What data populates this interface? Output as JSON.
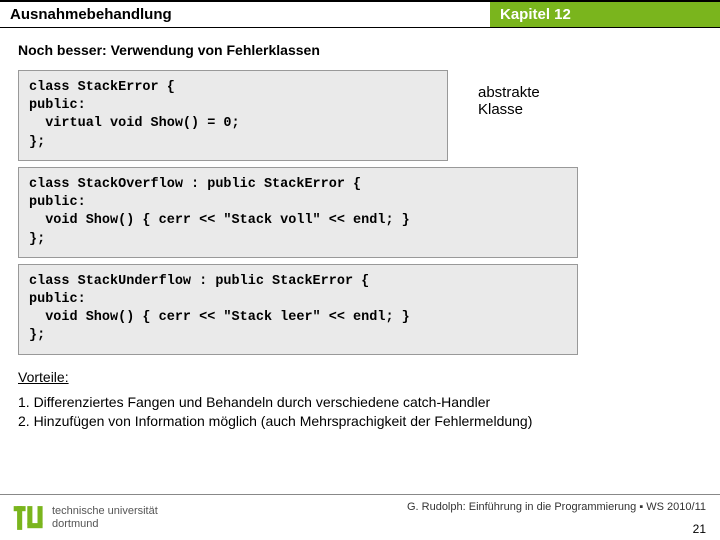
{
  "header": {
    "title": "Ausnahmebehandlung",
    "chapter": "Kapitel 12"
  },
  "subtitle": "Noch besser: Verwendung von Fehlerklassen",
  "code1": "class StackError {\npublic:\n  virtual void Show() = 0;\n};",
  "annot1": "abstrakte\nKlasse",
  "code2": "class StackOverflow : public StackError {\npublic:\n  void Show() { cerr << \"Stack voll\" << endl; }\n};",
  "code3": "class StackUnderflow : public StackError {\npublic:\n  void Show() { cerr << \"Stack leer\" << endl; }\n};",
  "vorteile_label": "Vorteile:",
  "advantages": "1. Differenziertes Fangen und Behandeln durch verschiedene catch-Handler\n2. Hinzufügen von Information möglich (auch Mehrsprachigkeit der Fehlermeldung)",
  "footer": {
    "uni1": "technische universität",
    "uni2": "dortmund",
    "credit": "G. Rudolph: Einführung in die Programmierung ▪ WS 2010/11",
    "page": "21"
  }
}
